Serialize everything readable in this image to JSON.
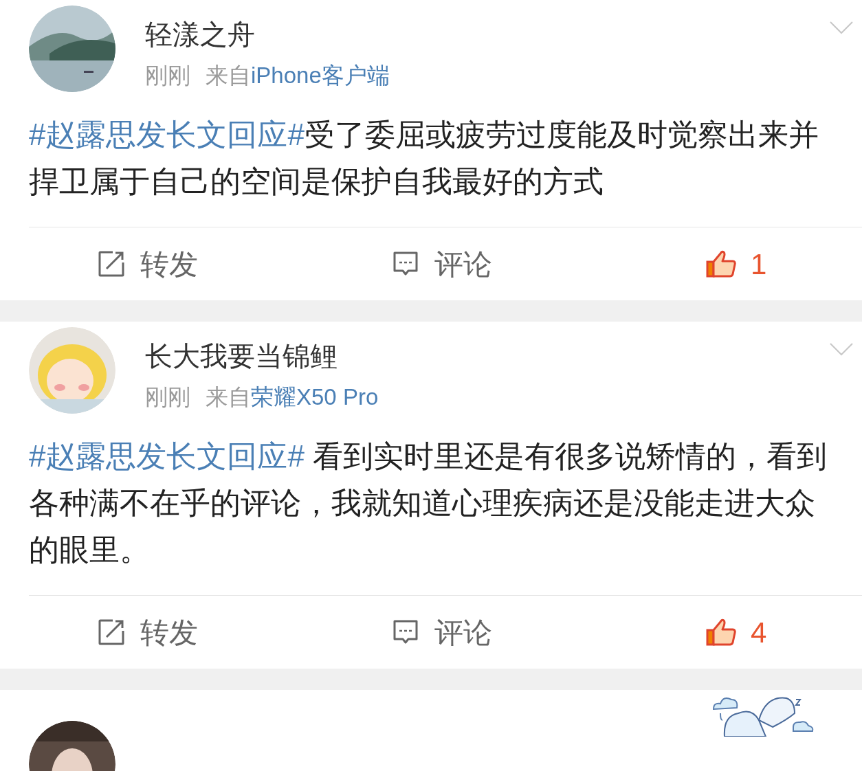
{
  "posts": [
    {
      "name": "轻漾之舟",
      "time": "刚刚",
      "source_prefix": "来自",
      "source": "iPhone客户端",
      "topic": "#赵露思发长文回应#",
      "body": "受了委屈或疲劳过度能及时觉察出来并捍卫属于自己的空间是保护自我最好的方式",
      "actions": {
        "repost": "转发",
        "comment": "评论",
        "likes": "1",
        "liked": true
      }
    },
    {
      "name": "长大我要当锦鲤",
      "time": "刚刚",
      "source_prefix": "来自",
      "source": "荣耀X50 Pro",
      "topic": "#赵露思发长文回应#",
      "body": " 看到实时里还是有很多说矫情的，看到各种满不在乎的评论，我就知道心理疾病还是没能走进大众的眼里。",
      "actions": {
        "repost": "转发",
        "comment": "评论",
        "likes": "4",
        "liked": true
      }
    }
  ]
}
